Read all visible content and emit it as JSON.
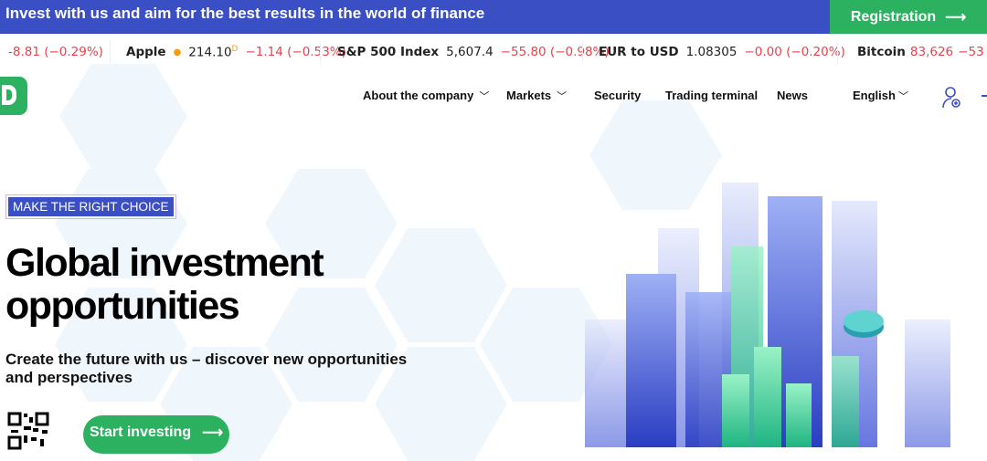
{
  "promo": {
    "text": "Invest with us and aim for the best results in the world of finance",
    "registration": "Registration"
  },
  "ticker": [
    {
      "name": "",
      "price": "",
      "change": "-8.81 (−0.29%)"
    },
    {
      "name": "Apple",
      "price": "214.10",
      "marker": "D",
      "change": "−1.14 (−0.53%)"
    },
    {
      "name": "S&P 500 Index",
      "price": "5,607.4",
      "change": "−55.80 (−0.98%)"
    },
    {
      "name": "EUR to USD",
      "price": "1.08305",
      "change": "−0.00 (−0.20%)"
    },
    {
      "name": "Bitcoin",
      "price": "83,626",
      "change": "−53"
    }
  ],
  "nav": {
    "about": "About the company",
    "markets": "Markets",
    "security": "Security",
    "terminal": "Trading terminal",
    "news": "News",
    "language": "English"
  },
  "hero": {
    "badge": "MAKE THE RIGHT CHOICE",
    "title_line1": "Global investment",
    "title_line2": "opportunities",
    "subtitle": "Create the future with us – discover new opportunities and perspectives",
    "cta": "Start investing"
  },
  "colors": {
    "primary": "#3b4fc4",
    "green": "#2bb15f",
    "negative": "#e8434c"
  }
}
